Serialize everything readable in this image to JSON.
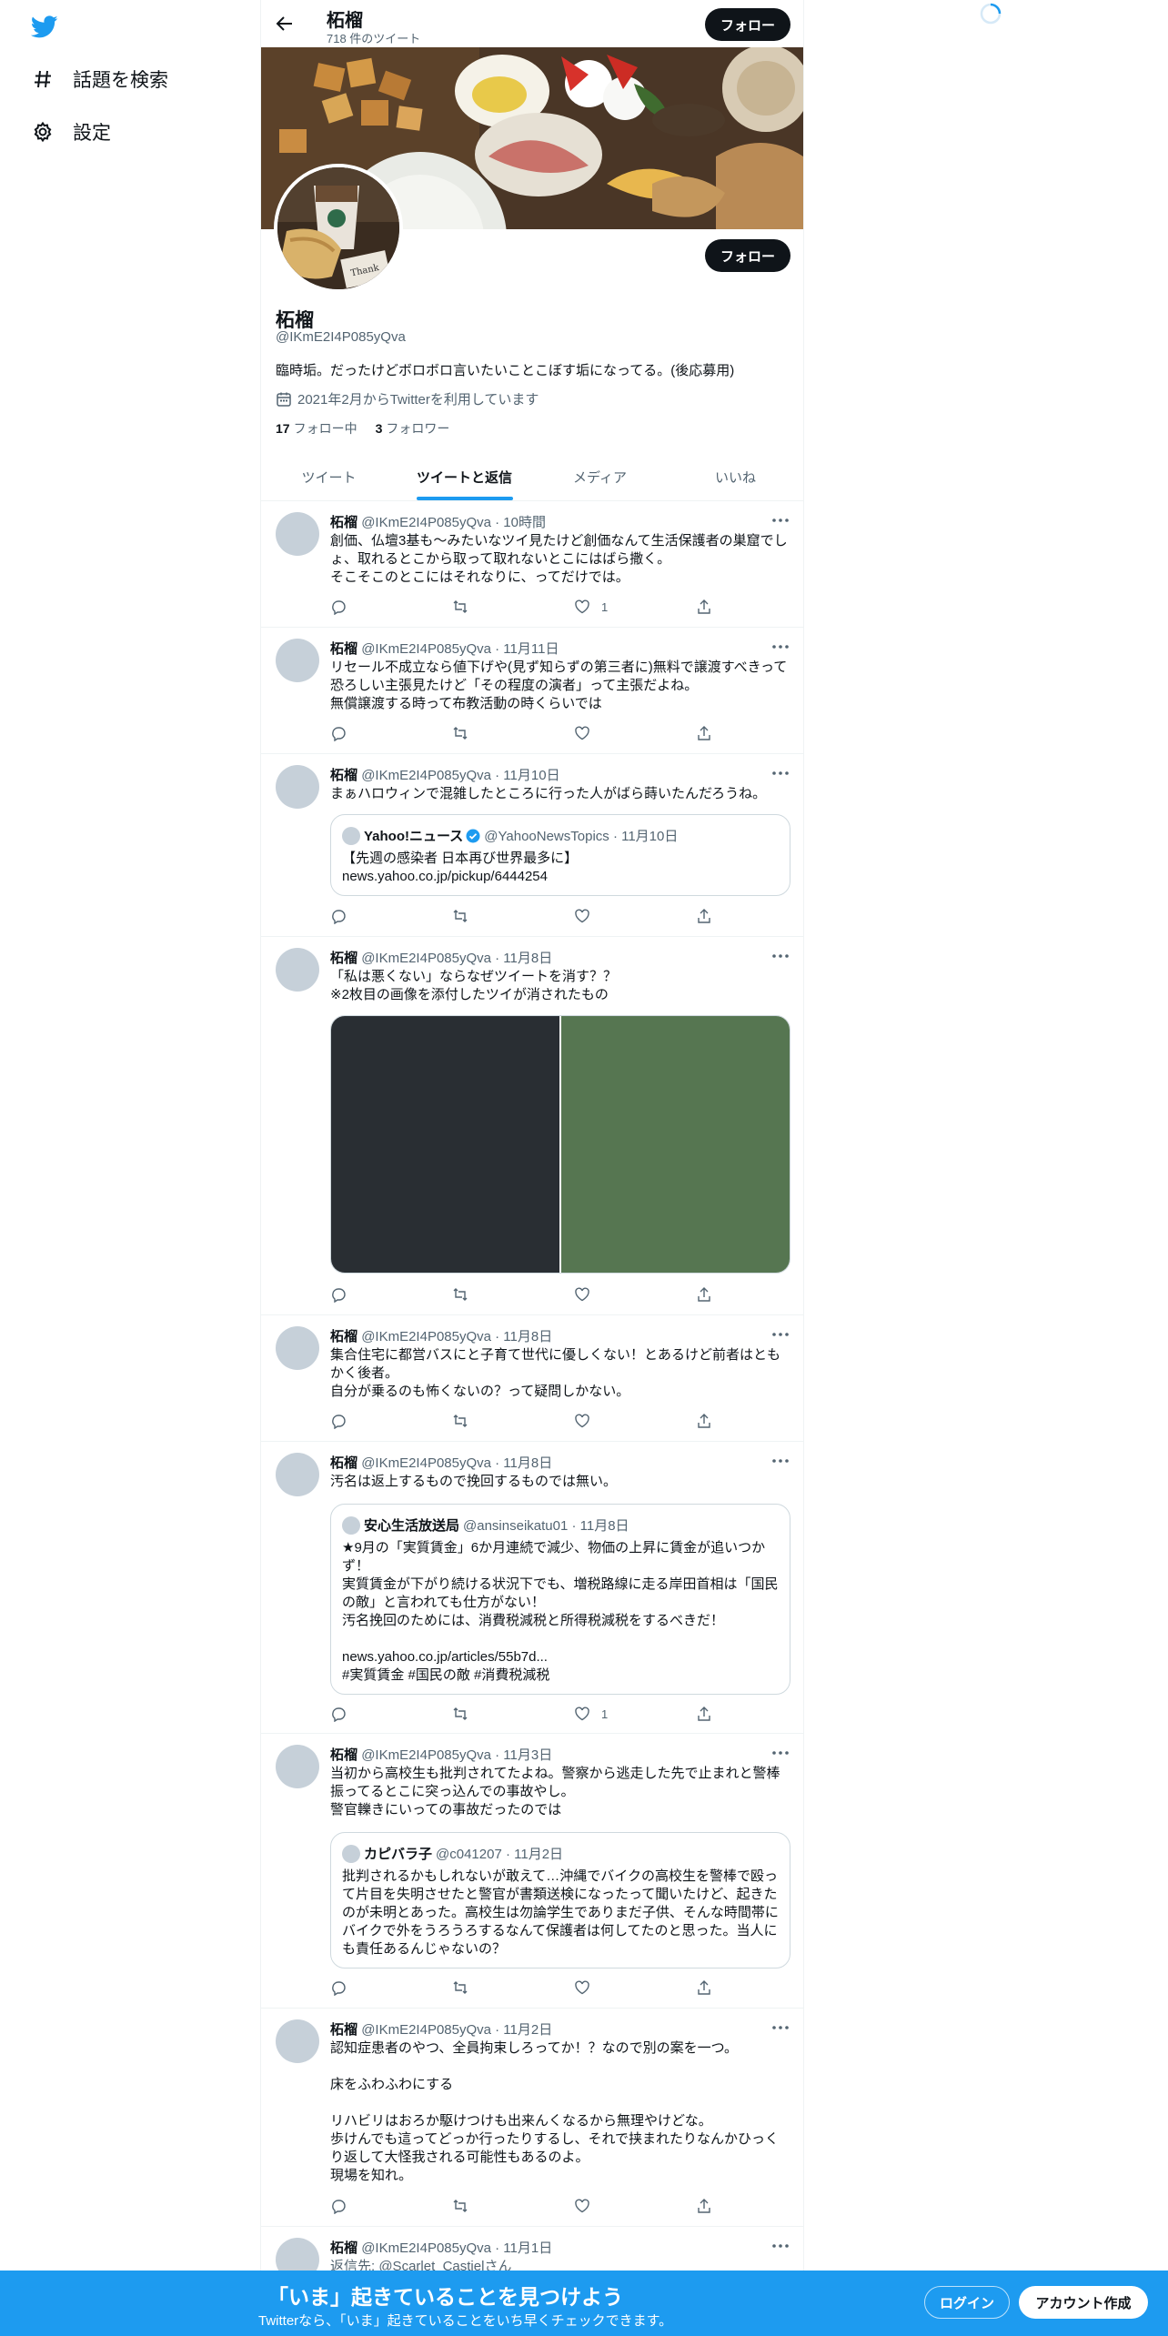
{
  "nav": {
    "explore_label": "話題を検索",
    "settings_label": "設定"
  },
  "profile": {
    "name": "柘榴",
    "tweet_count": "718 件のツイート",
    "handle": "@IKmE2I4P085yQva",
    "bio": "臨時垢。だったけどボロボロ言いたいことこぼす垢になってる。(後応募用)",
    "joined": "2021年2月からTwitterを利用しています",
    "following_count": "17",
    "following_label": "フォロー中",
    "followers_count": "3",
    "followers_label": "フォロワー",
    "follow_label": "フォロー"
  },
  "tabs": [
    "ツイート",
    "ツイートと返信",
    "メディア",
    "いいね"
  ],
  "tweets": [
    {
      "name": "柘榴",
      "meta": "@IKmE2I4P085yQva · 10時間",
      "text": "創価、仏壇3基も～みたいなツイ見たけど創価なんて生活保護者の巣窟でしょ、取れるとこから取って取れないとこにはばら撒く。\nそこそこのとこにはそれなりに、ってだけでは。",
      "likes": "1"
    },
    {
      "name": "柘榴",
      "meta": "@IKmE2I4P085yQva · 11月11日",
      "text": "リセール不成立なら値下げや(見ず知らずの第三者に)無料で譲渡すべきって恐ろしい主張見たけど「その程度の演者」って主張だよね。\n無償譲渡する時って布教活動の時くらいでは",
      "likes": ""
    },
    {
      "name": "柘榴",
      "meta": "@IKmE2I4P085yQva · 11月10日",
      "text": "まぁハロウィンで混雑したところに行った人がばら蒔いたんだろうね。",
      "likes": "",
      "quote": {
        "name": "Yahoo!ニュース",
        "meta": "@YahooNewsTopics · 11月10日",
        "text": "【先週の感染者 日本再び世界最多に】\nnews.yahoo.co.jp/pickup/6444254"
      }
    },
    {
      "name": "柘榴",
      "meta": "@IKmE2I4P085yQva · 11月8日",
      "text": "「私は悪くない」ならなぜツイートを消す？？\n※2枚目の画像を添付したツイが消されたもの",
      "likes": ""
    },
    {
      "name": "柘榴",
      "meta": "@IKmE2I4P085yQva · 11月8日",
      "text": "集合住宅に都営バスにと子育て世代に優しくない！とあるけど前者はともかく後者。\n自分が乗るのも怖くないの？って疑問しかない。",
      "likes": ""
    },
    {
      "name": "柘榴",
      "meta": "@IKmE2I4P085yQva · 11月8日",
      "text": "汚名は返上するもので挽回するものでは無い。",
      "likes": "1",
      "quote": {
        "name": "安心生活放送局",
        "meta": "@ansinseikatu01 · 11月8日",
        "text": "★9月の「実質賃金」6か月連続で減少、物価の上昇に賃金が追いつかず！\n実質賃金が下がり続ける状況下でも、増税路線に走る岸田首相は「国民の敵」と言われても仕方がない！\n汚名挽回のためには、消費税減税と所得税減税をするべきだ！\n\nnews.yahoo.co.jp/articles/55b7d...\n#実質賃金 #国民の敵 #消費税減税"
      }
    },
    {
      "name": "柘榴",
      "meta": "@IKmE2I4P085yQva · 11月3日",
      "text": "当初から高校生も批判されてたよね。警察から逃走した先で止まれと警棒振ってるとこに突っ込んでの事故やし。\n警官轢きにいっての事故だったのでは",
      "likes": "",
      "quote": {
        "name": "カピバラ子",
        "meta": "@c041207 · 11月2日",
        "text": "批判されるかもしれないが敢えて…沖縄でバイクの高校生を警棒で殴って片目を失明させたと警官が書類送検になったって聞いたけど、起きたのが未明とあった。高校生は勿論学生でありまだ子供、そんな時間帯にバイクで外をうろうろするなんて保護者は何してたのと思った。当人にも責任あるんじゃないの？"
      }
    },
    {
      "name": "柘榴",
      "meta": "@IKmE2I4P085yQva · 11月2日",
      "text": "認知症患者のやつ、全員拘束しろってか！？なので別の案を一つ。\n\n床をふわふわにする\n\nリハビリはおろか駆けつけも出来んくなるから無理やけどな。\n歩けんでも這ってどっか行ったりするし、それで挟まれたりなんかひっくり返して大怪我される可能性もあるのよ。\n現場を知れ。",
      "likes": ""
    },
    {
      "name": "柘榴",
      "meta": "@IKmE2I4P085yQva · 11月1日",
      "text": "返信先: @Scarlet_Castielさん",
      "likes": ""
    }
  ],
  "bottom_bar": {
    "title": "「いま」起きていることを見つけよう",
    "subtitle": "Twitterなら、「いま」起きていることをいち早くチェックできます。",
    "login_label": "ログイン",
    "signup_label": "アカウント作成"
  },
  "colors": {
    "accent": "#1d9bf0",
    "dark_button": "#0f1419",
    "muted_text": "#536471"
  }
}
